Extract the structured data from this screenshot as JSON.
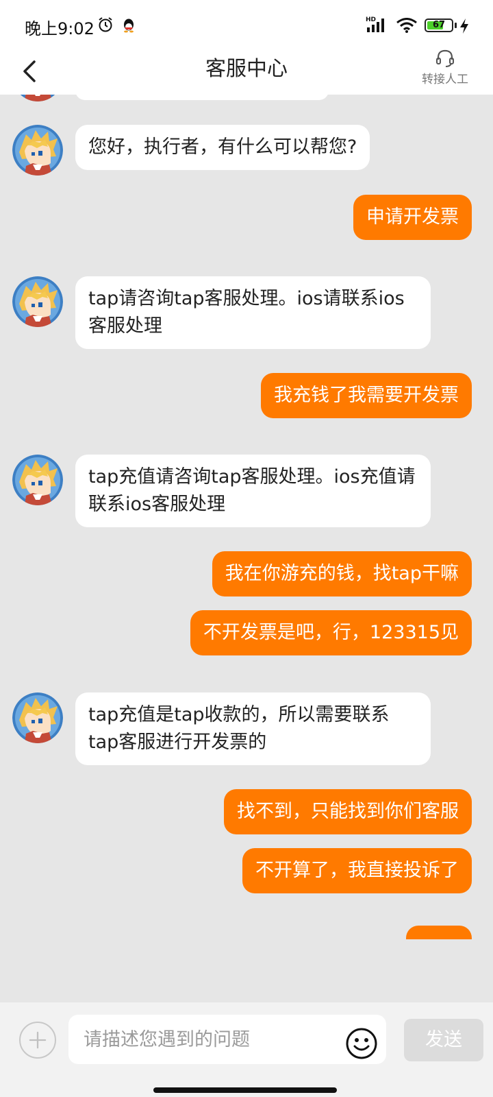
{
  "status_bar": {
    "time": "晚上9:02",
    "network": "HD",
    "battery_level": "67",
    "battery_fraction": 0.67,
    "icons": [
      "alarm-icon",
      "qq-icon",
      "signal-icon",
      "wifi-icon",
      "battery-icon",
      "charging-icon"
    ]
  },
  "header": {
    "title": "客服中心",
    "agent_label": "转接人工",
    "icons": [
      "back-icon",
      "headset-icon"
    ]
  },
  "colors": {
    "user_bubble": "#ff7a00",
    "bot_bubble": "#ffffff",
    "chat_background": "#e6e6e6",
    "send_button_disabled": "#dcdcdc"
  },
  "messages": [
    {
      "from": "bot",
      "text": "您好，执行者，有什么可以帮您?"
    },
    {
      "from": "user",
      "text": "申请开发票"
    },
    {
      "from": "bot",
      "text": "tap请咨询tap客服处理。ios请联系ios客服处理"
    },
    {
      "from": "user",
      "text": "我充钱了我需要开发票"
    },
    {
      "from": "bot",
      "text": "tap充值请咨询tap客服处理。ios充值请联系ios客服处理"
    },
    {
      "from": "user",
      "text": "我在你游充的钱，找tap干嘛"
    },
    {
      "from": "user",
      "text": "不开发票是吧，行，123315见"
    },
    {
      "from": "bot",
      "text": "tap充值是tap收款的，所以需要联系tap客服进行开发票的"
    },
    {
      "from": "user",
      "text": "找不到，只能找到你们客服"
    },
    {
      "from": "user",
      "text": "不开算了，我直接投诉了"
    }
  ],
  "composer": {
    "placeholder": "请描述您遇到的问题",
    "send_label": "发送",
    "icons": [
      "plus-icon",
      "emoji-icon"
    ]
  }
}
